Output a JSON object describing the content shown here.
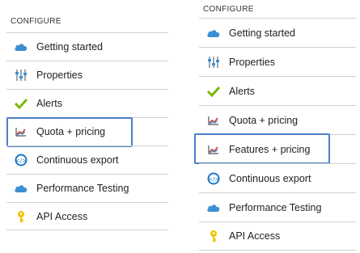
{
  "left_panel": {
    "header": "CONFIGURE",
    "items": [
      {
        "label": "Getting started",
        "icon": "cloud-icon"
      },
      {
        "label": "Properties",
        "icon": "properties-icon"
      },
      {
        "label": "Alerts",
        "icon": "checkmark-icon"
      },
      {
        "label": "Quota + pricing",
        "icon": "chart-icon",
        "highlighted": true
      },
      {
        "label": "Continuous export",
        "icon": "export-icon"
      },
      {
        "label": "Performance Testing",
        "icon": "cloud-icon"
      },
      {
        "label": "API Access",
        "icon": "key-icon"
      }
    ]
  },
  "right_panel": {
    "header": "CONFIGURE",
    "items": [
      {
        "label": "Getting started",
        "icon": "cloud-icon"
      },
      {
        "label": "Properties",
        "icon": "properties-icon"
      },
      {
        "label": "Alerts",
        "icon": "checkmark-icon"
      },
      {
        "label": "Quota + pricing",
        "icon": "chart-icon"
      },
      {
        "label": "Features + pricing",
        "icon": "chart-icon",
        "highlighted": true
      },
      {
        "label": "Continuous export",
        "icon": "export-icon"
      },
      {
        "label": "Performance Testing",
        "icon": "cloud-icon"
      },
      {
        "label": "API Access",
        "icon": "key-icon"
      }
    ]
  },
  "colors": {
    "highlight_border": "#4a7fc9",
    "cloud": "#3b8fd3",
    "check": "#7ab800",
    "key": "#f2c200",
    "export": "#1e78c8"
  }
}
